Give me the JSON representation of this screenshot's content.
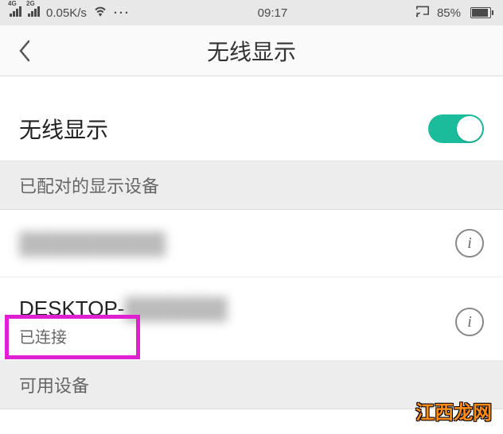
{
  "status_bar": {
    "sig1_label": "4G",
    "sig2_label": "2G",
    "net_speed": "0.05K/s",
    "dots": "···",
    "time": "09:17",
    "battery_pct": "85%"
  },
  "header": {
    "title": "无线显示"
  },
  "toggle": {
    "label": "无线显示",
    "on": true
  },
  "sections": {
    "paired_header": "已配对的显示设备",
    "available_header": "可用设备"
  },
  "devices": [
    {
      "name": "██████████",
      "status": "",
      "info": "i"
    },
    {
      "name": "DESKTOP-███████",
      "name_prefix": "DESKTOP-",
      "status": "已连接",
      "info": "i"
    }
  ],
  "watermark": "江西龙网",
  "colors": {
    "accent": "#1abc9c",
    "highlight": "#e020d0"
  }
}
